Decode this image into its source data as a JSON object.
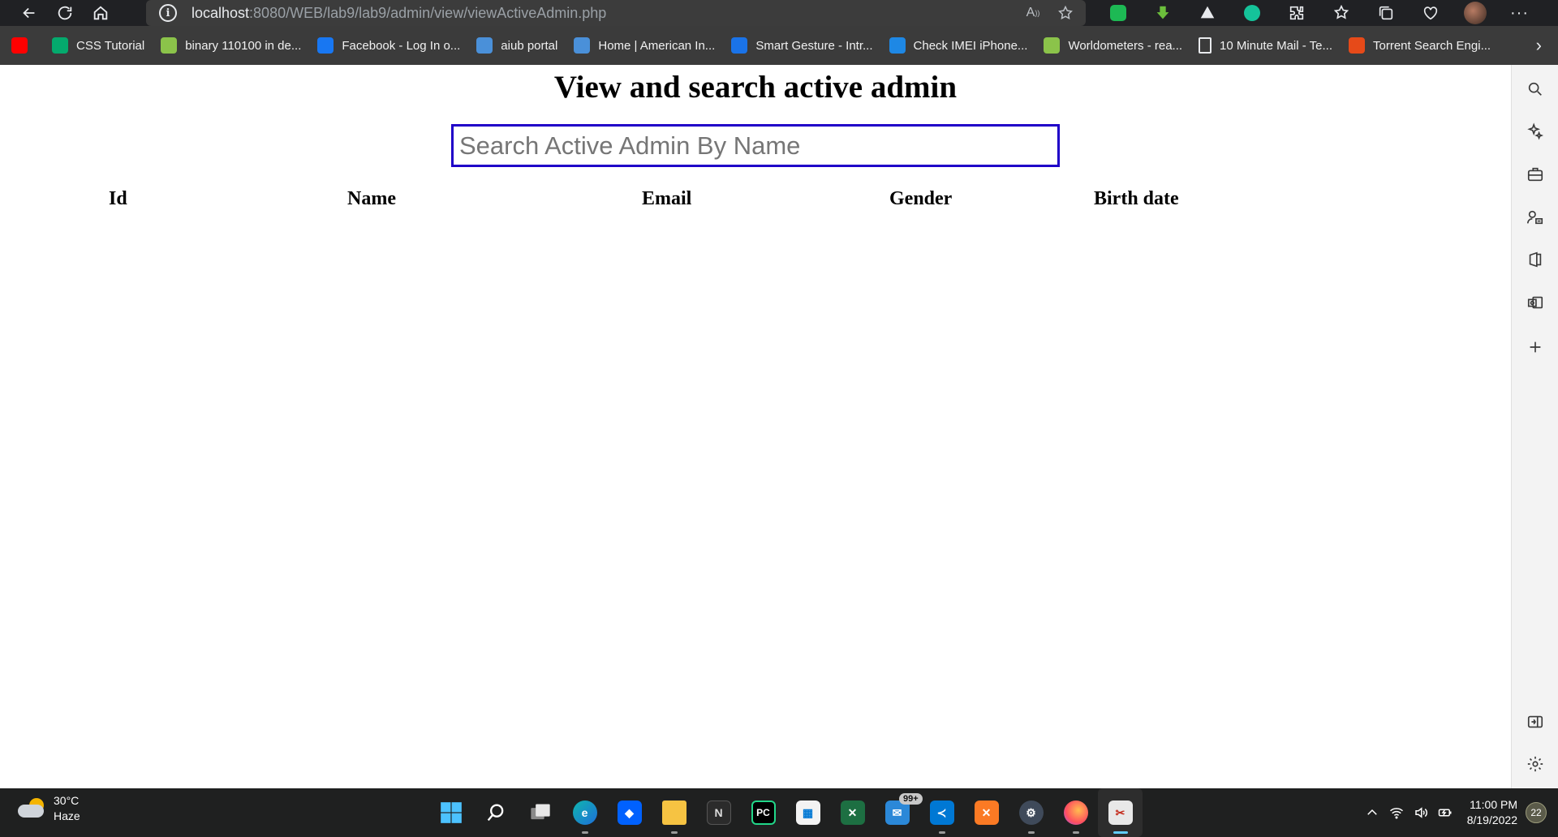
{
  "browser": {
    "url_host": "localhost",
    "url_path": ":8080/WEB/lab9/lab9/admin/view/viewActiveAdmin.php"
  },
  "bookmarks": [
    {
      "label": "",
      "icon": "youtube-icon",
      "color": "#ff0000"
    },
    {
      "label": "CSS Tutorial",
      "icon": "w3schools-icon",
      "color": "#04aa6d"
    },
    {
      "label": "binary 110100 in de...",
      "icon": "google-loading-icon",
      "color": "#8bc34a"
    },
    {
      "label": "Facebook - Log In o...",
      "icon": "facebook-icon",
      "color": "#1877f2"
    },
    {
      "label": "aiub portal",
      "icon": "aiub-icon",
      "color": "#4a90d9"
    },
    {
      "label": "Home | American In...",
      "icon": "aiub-home-icon",
      "color": "#4a90d9"
    },
    {
      "label": "Smart Gesture - Intr...",
      "icon": "asus-icon",
      "color": "#1a73e8"
    },
    {
      "label": "Check IMEI iPhone...",
      "icon": "imei-icon",
      "color": "#1e88e5"
    },
    {
      "label": "Worldometers - rea...",
      "icon": "worldometers-icon",
      "color": "#8bc34a"
    },
    {
      "label": "10 Minute Mail - Te...",
      "icon": "page-icon",
      "color": "#3b3b3b"
    },
    {
      "label": "Torrent Search Engi...",
      "icon": "torrent-icon",
      "color": "#e64a19"
    }
  ],
  "page": {
    "title": "View and search active admin",
    "search_placeholder": "Search Active Admin By Name",
    "columns": [
      "Id",
      "Name",
      "Email",
      "Gender",
      "Birth date"
    ]
  },
  "taskbar": {
    "temperature": "30°C",
    "weather": "Haze",
    "mail_badge": "99+",
    "time": "11:00 PM",
    "date": "8/19/2022",
    "notifications": "22"
  }
}
